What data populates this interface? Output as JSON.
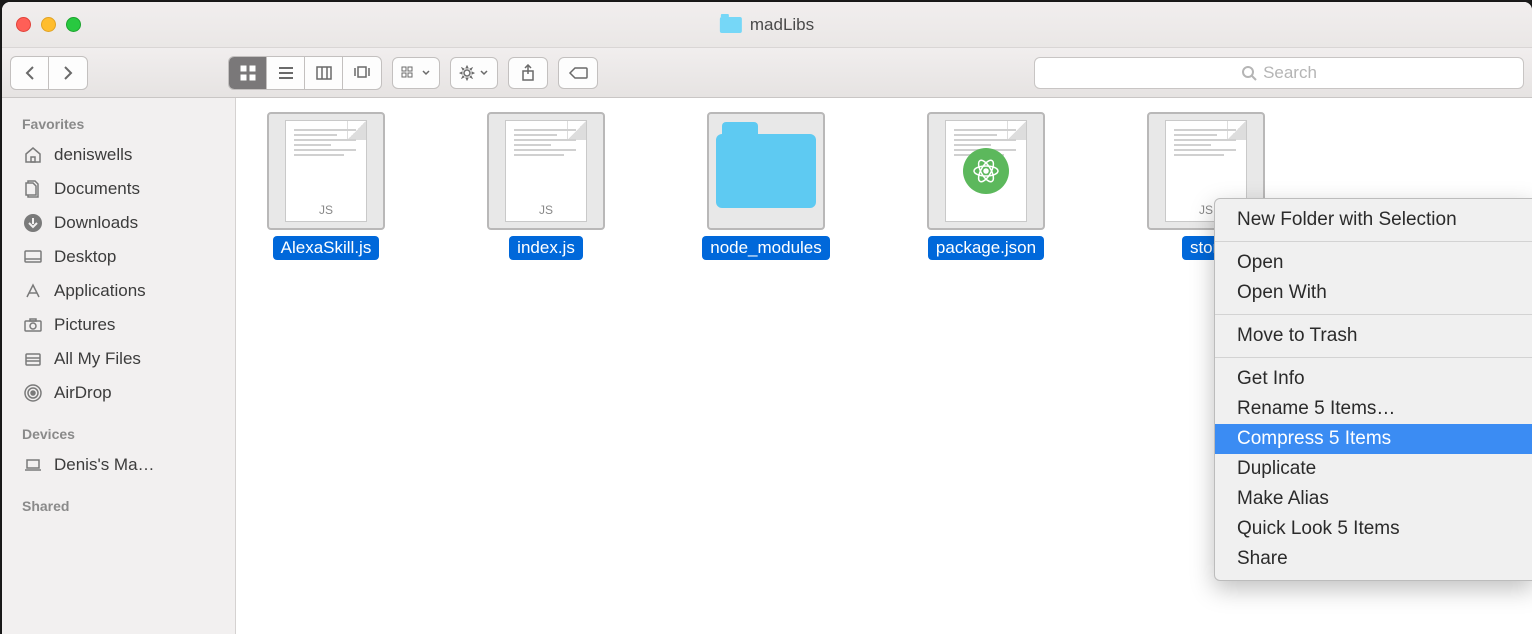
{
  "window": {
    "title": "madLibs"
  },
  "search": {
    "placeholder": "Search"
  },
  "sidebar": {
    "sections": [
      {
        "title": "Favorites",
        "items": [
          {
            "icon": "home-icon",
            "label": "deniswells"
          },
          {
            "icon": "document-icon",
            "label": "Documents"
          },
          {
            "icon": "download-icon",
            "label": "Downloads"
          },
          {
            "icon": "desktop-icon",
            "label": "Desktop"
          },
          {
            "icon": "applications-icon",
            "label": "Applications"
          },
          {
            "icon": "camera-icon",
            "label": "Pictures"
          },
          {
            "icon": "all-files-icon",
            "label": "All My Files"
          },
          {
            "icon": "airdrop-icon",
            "label": "AirDrop"
          }
        ]
      },
      {
        "title": "Devices",
        "items": [
          {
            "icon": "laptop-icon",
            "label": "Denis's Ma…"
          }
        ]
      },
      {
        "title": "Shared",
        "items": []
      }
    ]
  },
  "files": [
    {
      "name": "AlexaSkill.js",
      "type": "js"
    },
    {
      "name": "index.js",
      "type": "js"
    },
    {
      "name": "node_modules",
      "type": "folder"
    },
    {
      "name": "package.json",
      "type": "json"
    },
    {
      "name": "stori",
      "type": "js"
    }
  ],
  "contextMenu": {
    "groups": [
      [
        "New Folder with Selection"
      ],
      [
        "Open",
        "Open With"
      ],
      [
        "Move to Trash"
      ],
      [
        "Get Info",
        "Rename 5 Items…",
        "Compress 5 Items",
        "Duplicate",
        "Make Alias",
        "Quick Look 5 Items",
        "Share"
      ]
    ],
    "highlighted": "Compress 5 Items"
  }
}
